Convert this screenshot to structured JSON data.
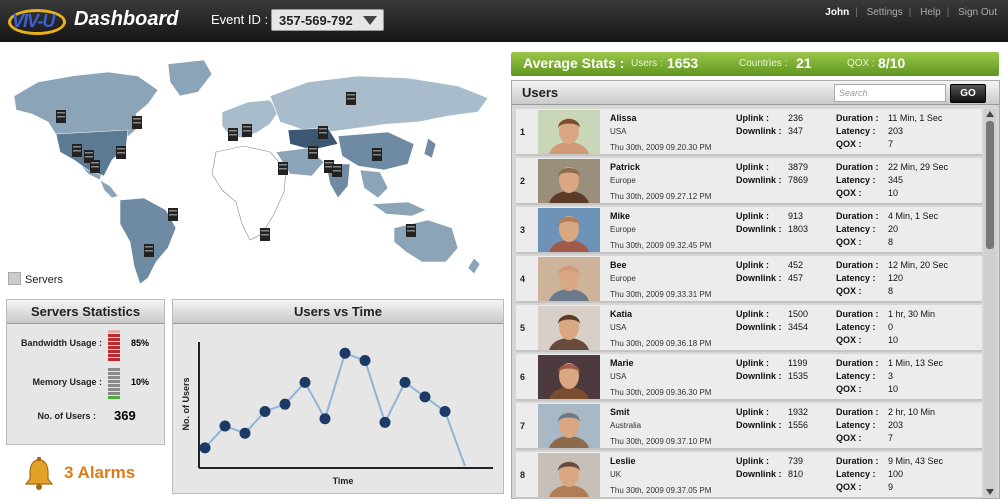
{
  "header": {
    "logo_text": "VIV-U",
    "app_title": "Dashboard",
    "event_label": "Event ID :",
    "event_id": "357-569-792",
    "user": "John",
    "links": [
      "Settings",
      "Help",
      "Sign Out"
    ]
  },
  "map": {
    "legend_label": "Servers"
  },
  "stats_panel": {
    "title": "Servers Statistics",
    "bandwidth_label": "Bandwidth Usage :",
    "bandwidth_value": "85%",
    "bandwidth_level": 0.85,
    "memory_label": "Memory Usage :",
    "memory_value": "10%",
    "memory_level": 0.1,
    "users_label": "No. of Users :",
    "users_value": "369"
  },
  "alarms": {
    "text": "3 Alarms"
  },
  "chart_panel": {
    "title": "Users vs Time"
  },
  "chart_data": {
    "type": "line",
    "xlabel": "Time",
    "ylabel": "No. of Users",
    "values": [
      5,
      11,
      9,
      15,
      17,
      23,
      13,
      31,
      29,
      12,
      23,
      19,
      15,
      0
    ],
    "ylim": [
      0,
      33
    ],
    "grid": false
  },
  "avg_stats": {
    "title": "Average Stats :",
    "users_label": "Users :",
    "users_value": "1653",
    "countries_label": "Countries :",
    "countries_value": "21",
    "qox_label": "QOX :",
    "qox_value": "8/10",
    "color": "#6fa52e"
  },
  "users_panel": {
    "title": "Users",
    "search_placeholder": "Search",
    "go_label": "GO",
    "labels": {
      "uplink": "Uplink :",
      "downlink": "Downlink :",
      "duration": "Duration :",
      "latency": "Latency :",
      "qox": "QOX :"
    },
    "rows": [
      {
        "index": "1",
        "name": "Alissa",
        "location": "USA",
        "date": "Thu 30th, 2009 09.20.30 PM",
        "uplink": "236",
        "downlink": "347",
        "duration": "11 Min, 1 Sec",
        "latency": "203",
        "qox": "7"
      },
      {
        "index": "2",
        "name": "Patrick",
        "location": "Europe",
        "date": "Thu 30th, 2009 09.27.12 PM",
        "uplink": "3879",
        "downlink": "7869",
        "duration": "22 Min, 29 Sec",
        "latency": "345",
        "qox": "10"
      },
      {
        "index": "3",
        "name": "Mike",
        "location": "Europe",
        "date": "Thu 30th, 2009 09.32.45 PM",
        "uplink": "913",
        "downlink": "1803",
        "duration": "4 Min, 1 Sec",
        "latency": "20",
        "qox": "8"
      },
      {
        "index": "4",
        "name": "Bee",
        "location": "Europe",
        "date": "Thu 30th, 2009 09.33.31 PM",
        "uplink": "452",
        "downlink": "457",
        "duration": "12 Min, 20 Sec",
        "latency": "120",
        "qox": "8"
      },
      {
        "index": "5",
        "name": "Katia",
        "location": "USA",
        "date": "Thu 30th, 2009 09.36.18 PM",
        "uplink": "1500",
        "downlink": "3454",
        "duration": "1 hr, 30 Min",
        "latency": "0",
        "qox": "10"
      },
      {
        "index": "6",
        "name": "Marie",
        "location": "USA",
        "date": "Thu 30th, 2009 09.36.30 PM",
        "uplink": "1199",
        "downlink": "1535",
        "duration": "1 Min, 13 Sec",
        "latency": "3",
        "qox": "10"
      },
      {
        "index": "7",
        "name": "Smit",
        "location": "Australia",
        "date": "Thu 30th, 2009 09.37.10 PM",
        "uplink": "1932",
        "downlink": "1556",
        "duration": "2 hr, 10 Min",
        "latency": "203",
        "qox": "7"
      },
      {
        "index": "8",
        "name": "Leslie",
        "location": "UK",
        "date": "Thu 30th, 2009 09.37.05 PM",
        "uplink": "739",
        "downlink": "810",
        "duration": "9 Min, 43 Sec",
        "latency": "100",
        "qox": "9"
      }
    ]
  }
}
